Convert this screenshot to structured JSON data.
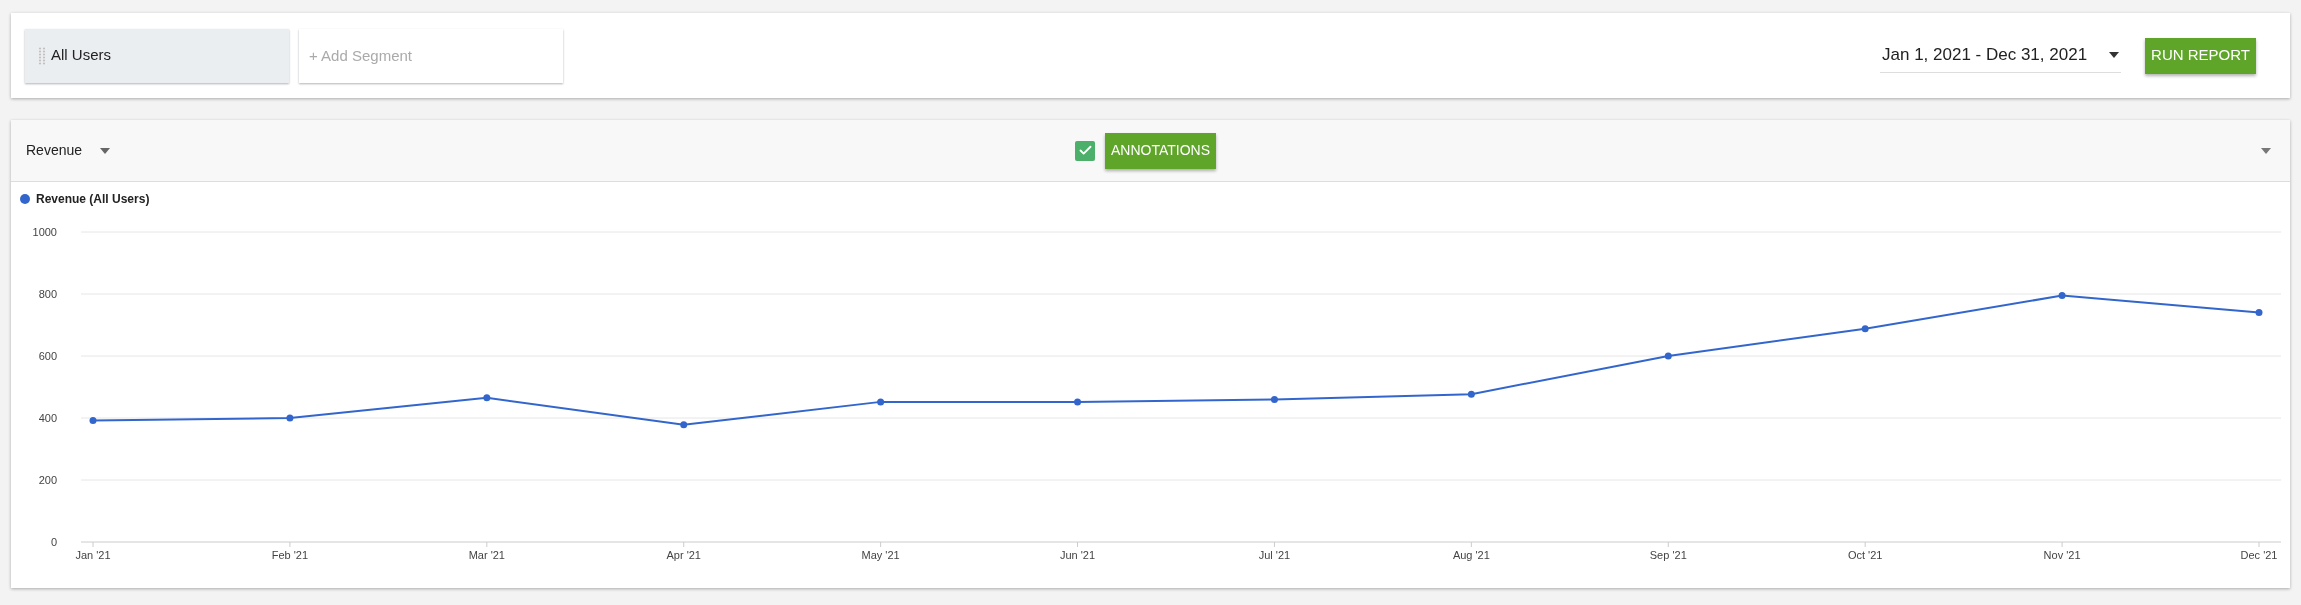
{
  "segments": {
    "items": [
      {
        "label": "All Users"
      }
    ],
    "add_placeholder": "+ Add Segment"
  },
  "date_range": {
    "value": "Jan 1, 2021 - Dec 31, 2021"
  },
  "run_button": "RUN REPORT",
  "panel": {
    "metric": "Revenue",
    "annotations": {
      "checked": true,
      "label": "ANNOTATIONS"
    },
    "chart_data": {
      "type": "line",
      "categories": [
        "Jan '21",
        "Feb '21",
        "Mar '21",
        "Apr '21",
        "May '21",
        "Jun '21",
        "Jul '21",
        "Aug '21",
        "Sep '21",
        "Oct '21",
        "Nov '21",
        "Dec '21"
      ],
      "grid": true,
      "series": [
        {
          "name": "Revenue (All Users)",
          "color": "#3366cc",
          "marker": true,
          "values": [
            392,
            400,
            465,
            378,
            452,
            452,
            460,
            477,
            600,
            688,
            795,
            740
          ]
        }
      ],
      "ylim": [
        0,
        1000
      ],
      "yticks": [
        0,
        200,
        400,
        600,
        800,
        1000
      ]
    }
  }
}
